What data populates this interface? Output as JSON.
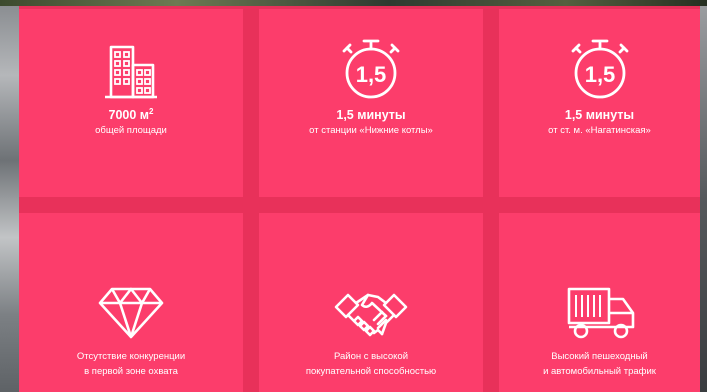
{
  "colors": {
    "tile": "#fc3d6b",
    "gap": "#e8315a",
    "icon": "#ffffff"
  },
  "features": [
    {
      "icon": "buildings-icon",
      "title": "7000 м",
      "title_sup": "2",
      "subtitle": "общей площади"
    },
    {
      "icon": "stopwatch-icon",
      "badge": "1,5",
      "title": "1,5 минуты",
      "subtitle": "от станции «Нижние котлы»"
    },
    {
      "icon": "stopwatch-icon",
      "badge": "1,5",
      "title": "1,5 минуты",
      "subtitle": "от ст. м. «Нагатинская»"
    },
    {
      "icon": "diamond-icon",
      "line1": "Отсутствие конкуренции",
      "line2": "в первой зоне охвата"
    },
    {
      "icon": "handshake-icon",
      "line1": "Район с высокой",
      "line2": "покупательной способностью"
    },
    {
      "icon": "truck-icon",
      "line1": "Высокий пешеходный",
      "line2": "и автомобильный трафик"
    }
  ]
}
